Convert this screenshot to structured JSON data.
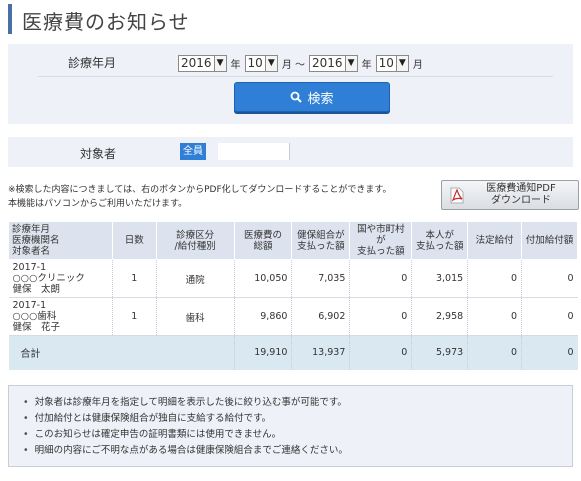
{
  "page": {
    "title": "医療費のお知らせ"
  },
  "search": {
    "label": "診療年月",
    "from_year": "2016",
    "year_unit_1": "年",
    "from_month": "10",
    "month_unit_1": "月 ～",
    "to_year": "2016",
    "year_unit_2": "年",
    "to_month": "10",
    "month_unit_2": "月",
    "button_label": "検索"
  },
  "target": {
    "label": "対象者",
    "all_label": "全員",
    "field_value": ""
  },
  "note": {
    "line1": "※検索した内容につきましては、右のボタンからPDF化してダウンロードすることができます。",
    "line2": "本機能はパソコンからご利用いただけます。"
  },
  "pdf_button": {
    "line1": "医療費通知PDF",
    "line2": "ダウンロード"
  },
  "table": {
    "headers": [
      {
        "l1": "診療年月",
        "l2": "医療機関名",
        "l3": "対象者名"
      },
      {
        "l1": "日数",
        "l2": "",
        "l3": ""
      },
      {
        "l1": "診療区分",
        "l2": "/給付種別",
        "l3": ""
      },
      {
        "l1": "医療費の",
        "l2": "総額",
        "l3": ""
      },
      {
        "l1": "健保組合が",
        "l2": "支払った額",
        "l3": ""
      },
      {
        "l1": "国や市町村が",
        "l2": "支払った額",
        "l3": ""
      },
      {
        "l1": "本人が",
        "l2": "支払った額",
        "l3": ""
      },
      {
        "l1": "法定給付",
        "l2": "",
        "l3": ""
      },
      {
        "l1": "付加給付額",
        "l2": "",
        "l3": ""
      }
    ],
    "rows": [
      {
        "month": "2017-1",
        "facility": "○○○クリニック",
        "person": "健保　太朗",
        "days": "1",
        "category": "通院",
        "total": "10,050",
        "insurer": "7,035",
        "public": "0",
        "self": "3,015",
        "statutory": "0",
        "additional": "0"
      },
      {
        "month": "2017-1",
        "facility": "○○○歯科",
        "person": "健保　花子",
        "days": "1",
        "category": "歯科",
        "total": "9,860",
        "insurer": "6,902",
        "public": "0",
        "self": "2,958",
        "statutory": "0",
        "additional": "0"
      }
    ],
    "total_row": {
      "label": "合計",
      "total": "19,910",
      "insurer": "13,937",
      "public": "0",
      "self": "5,973",
      "statutory": "0",
      "additional": "0"
    }
  },
  "notices": [
    "対象者は診療年月を指定して明細を表示した後に絞り込む事が可能です。",
    "付加給付とは健康保険組合が独自に支給する給付です。",
    "このお知らせは確定申告の証明書類には使用できません。",
    "明細の内容にご不明な点がある場合は健康保険組合までご連絡ください。"
  ]
}
